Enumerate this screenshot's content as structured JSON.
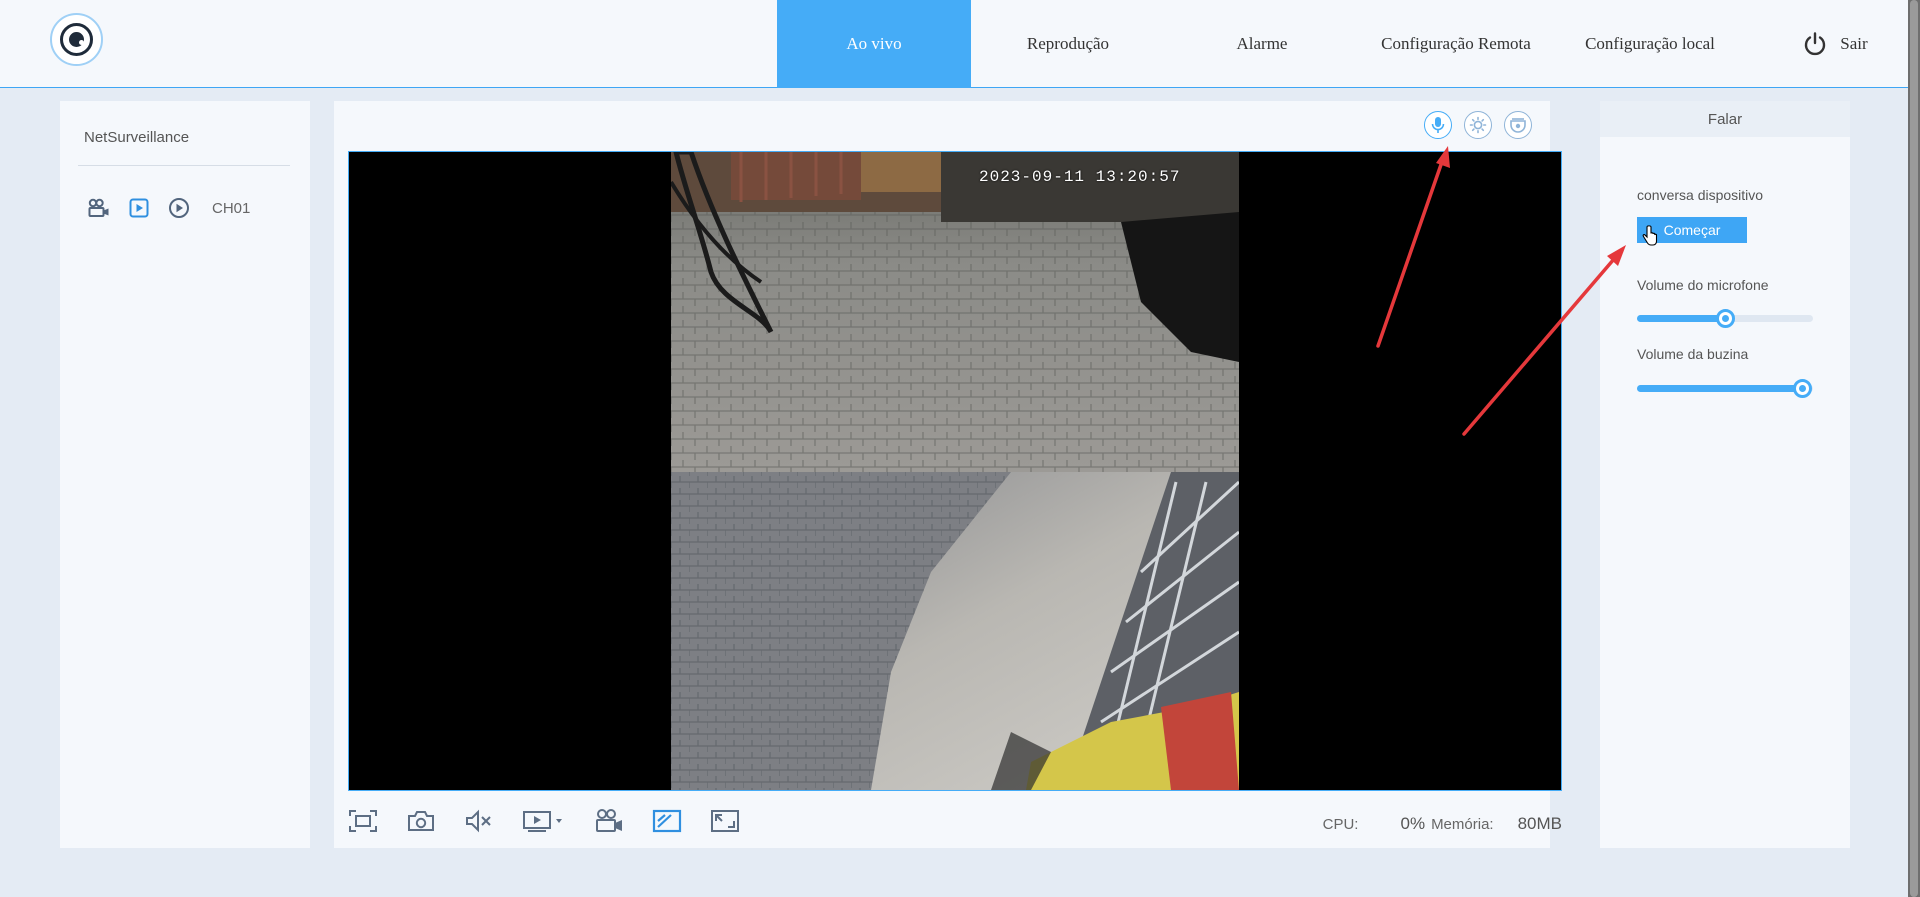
{
  "header": {
    "logo": "camera-eye-logo",
    "nav": [
      {
        "label": "Ao vivo",
        "active": true
      },
      {
        "label": "Reprodução",
        "active": false
      },
      {
        "label": "Alarme",
        "active": false
      },
      {
        "label": "Configuração Remota",
        "active": false
      },
      {
        "label": "Configuração local",
        "active": false
      }
    ],
    "exit_label": "Sair"
  },
  "left_panel": {
    "device_name": "NetSurveillance",
    "channel": {
      "label": "CH01",
      "icons": [
        "record-camera-icon",
        "live-play-icon",
        "playback-icon"
      ]
    }
  },
  "video": {
    "timestamp": "2023-09-11 13:20:57"
  },
  "top_tools": [
    "microphone-icon",
    "brightness-icon",
    "ptz-camera-icon"
  ],
  "bottom_tools": [
    "fit-screen-icon",
    "snapshot-icon",
    "mute-icon",
    "stream-select-icon",
    "record-icon",
    "aspect-ratio-icon",
    "fullscreen-icon"
  ],
  "stats": {
    "cpu_label": "CPU:",
    "cpu_value": "0%",
    "mem_label": "Memória:",
    "mem_value": "80MB"
  },
  "right_panel": {
    "title": "Falar",
    "intercom_label": "conversa dispositivo",
    "start_label": "Começar",
    "mic_volume_label": "Volume do microfone",
    "mic_volume": 0.5,
    "horn_volume_label": "Volume da buzina",
    "horn_volume": 0.94
  },
  "colors": {
    "accent": "#45acf7",
    "annotation_arrow": "#e5383b"
  }
}
